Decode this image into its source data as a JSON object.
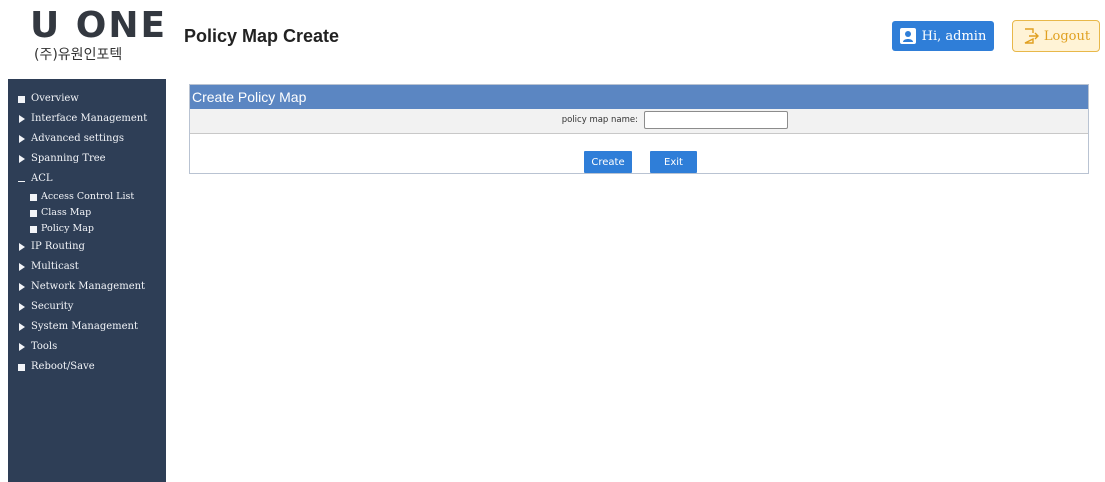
{
  "header": {
    "logo_main": "U ONE",
    "logo_sub": "(주)유원인포텍",
    "page_title": "Policy Map Create",
    "user_label": "Hi, admin",
    "logout_label": "Logout"
  },
  "sidebar": {
    "items": [
      {
        "label": "Overview",
        "icon": "square"
      },
      {
        "label": "Interface Management",
        "icon": "triangle"
      },
      {
        "label": "Advanced settings",
        "icon": "triangle"
      },
      {
        "label": "Spanning Tree",
        "icon": "triangle"
      },
      {
        "label": "ACL",
        "icon": "dash"
      },
      {
        "label": "Access Control List",
        "icon": "square",
        "sub": true
      },
      {
        "label": "Class Map",
        "icon": "square",
        "sub": true
      },
      {
        "label": "Policy Map",
        "icon": "square",
        "sub": true
      },
      {
        "label": "IP Routing",
        "icon": "triangle"
      },
      {
        "label": "Multicast",
        "icon": "triangle"
      },
      {
        "label": "Network Management",
        "icon": "triangle"
      },
      {
        "label": "Security",
        "icon": "triangle"
      },
      {
        "label": "System Management",
        "icon": "triangle"
      },
      {
        "label": "Tools",
        "icon": "triangle"
      },
      {
        "label": "Reboot/Save",
        "icon": "square"
      }
    ]
  },
  "main": {
    "panel_title": "Create Policy Map",
    "field_label": "policy map name:",
    "field_value": "",
    "create_label": "Create",
    "exit_label": "Exit"
  },
  "colors": {
    "sidebar_bg": "#2e3e56",
    "panel_header": "#5b86c2",
    "button_blue": "#2f7ed8",
    "logout_border": "#e8b84a"
  }
}
